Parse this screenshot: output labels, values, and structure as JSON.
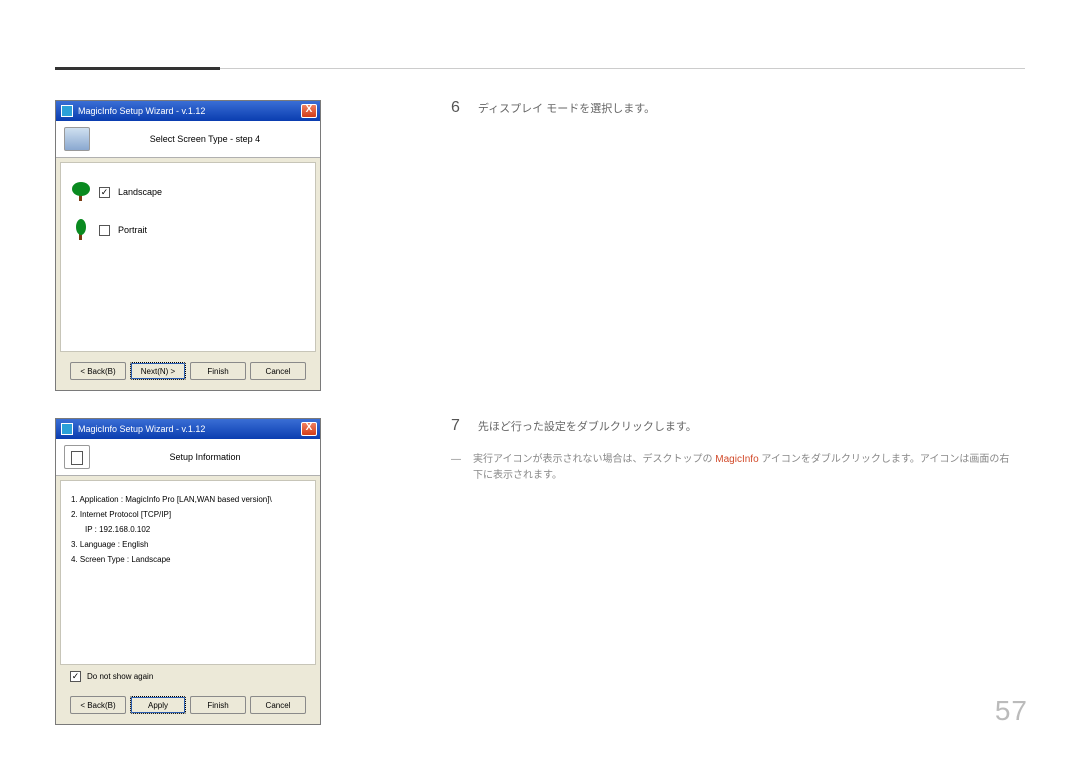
{
  "page_number": "57",
  "step6": {
    "number": "6",
    "text": "ディスプレイ モードを選択します。"
  },
  "step7": {
    "number": "7",
    "text": "先ほど行った設定をダブルクリックします。"
  },
  "note": {
    "dash": "―",
    "pre": "実行アイコンが表示されない場合は、デスクトップの ",
    "highlight": "MagicInfo",
    "post": " アイコンをダブルクリックします。アイコンは画面の右下に表示されます。"
  },
  "wizard1": {
    "title": "MagicInfo Setup Wizard - v.1.12",
    "close": "X",
    "header": "Select Screen Type - step 4",
    "opt_landscape": "Landscape",
    "opt_portrait": "Portrait",
    "btn_back": "< Back(B)",
    "btn_next": "Next(N) >",
    "btn_finish": "Finish",
    "btn_cancel": "Cancel"
  },
  "wizard2": {
    "title": "MagicInfo Setup Wizard - v.1.12",
    "close": "X",
    "header": "Setup Information",
    "line1": "1. Application :    MagicInfo Pro [LAN,WAN based version]\\",
    "line2": "2. Internet Protocol [TCP/IP]",
    "line_ip": "IP :      192.168.0.102",
    "line3": "3. Language :    English",
    "line4": "4. Screen Type :    Landscape",
    "noshow": "Do not show again",
    "btn_back": "< Back(B)",
    "btn_apply": "Apply",
    "btn_finish": "Finish",
    "btn_cancel": "Cancel"
  }
}
